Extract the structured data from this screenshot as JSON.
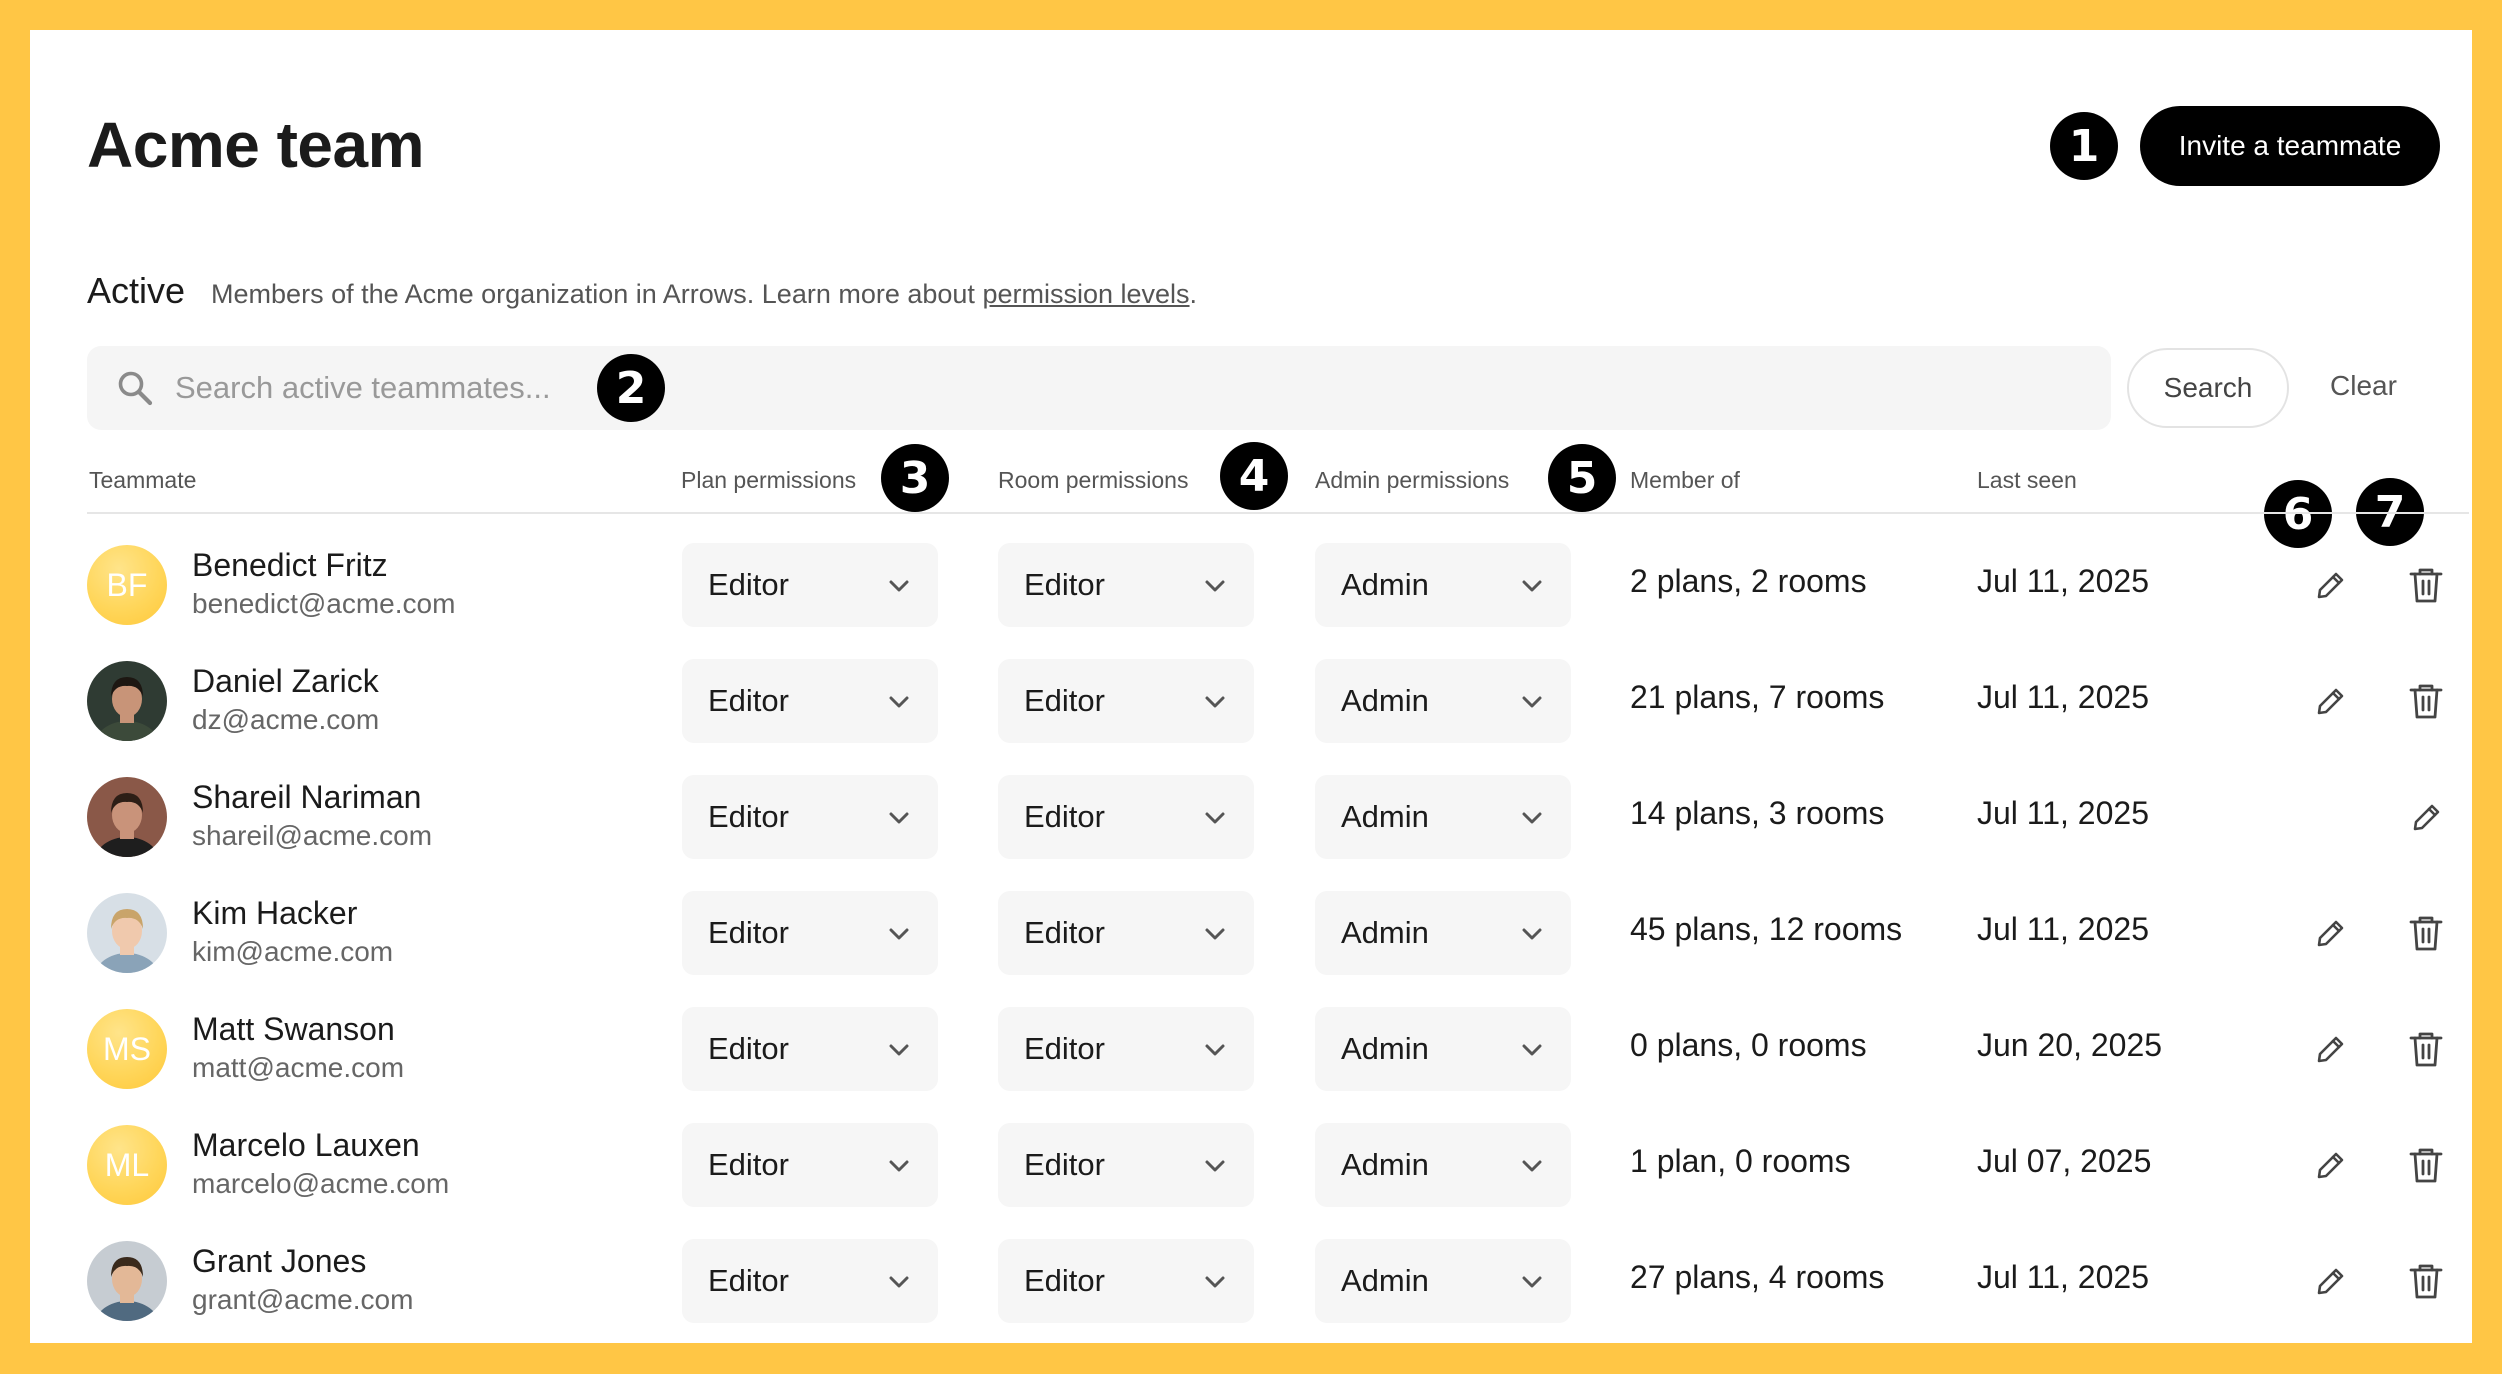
{
  "page": {
    "title": "Acme team",
    "invite_label": "Invite a teammate"
  },
  "section": {
    "title": "Active",
    "description": "Members of the Acme organization in Arrows. Learn more about",
    "link_text": "permission levels",
    "period": "."
  },
  "search": {
    "placeholder": "Search active teammates...",
    "button_label": "Search",
    "clear_label": "Clear"
  },
  "columns": {
    "teammate": "Teammate",
    "plan": "Plan permissions",
    "room": "Room permissions",
    "admin": "Admin permissions",
    "member_of": "Member of",
    "last_seen": "Last seen"
  },
  "callouts": [
    "1",
    "2",
    "3",
    "4",
    "5",
    "6",
    "7"
  ],
  "colors": {
    "background": "#FFC645",
    "accent_button": "#000000",
    "avatar_initials": "#FFD65A"
  },
  "icons": {
    "search": "search-icon",
    "dropdown": "chevron-down-icon",
    "edit": "pencil-icon",
    "delete": "trash-icon"
  },
  "rows": [
    {
      "name": "Benedict Fritz",
      "email": "benedict@acme.com",
      "avatar_initials": "BF",
      "avatar_type": "initials",
      "plan": "Editor",
      "room": "Editor",
      "admin": "Admin",
      "member_of": "2 plans, 2 rooms",
      "last_seen": "Jul 11, 2025",
      "can_delete": true
    },
    {
      "name": "Daniel Zarick",
      "email": "dz@acme.com",
      "avatar_initials": "",
      "avatar_type": "photo",
      "plan": "Editor",
      "room": "Editor",
      "admin": "Admin",
      "member_of": "21 plans, 7 rooms",
      "last_seen": "Jul 11, 2025",
      "can_delete": true
    },
    {
      "name": "Shareil Nariman",
      "email": "shareil@acme.com",
      "avatar_initials": "",
      "avatar_type": "photo",
      "plan": "Editor",
      "room": "Editor",
      "admin": "Admin",
      "member_of": "14 plans, 3 rooms",
      "last_seen": "Jul 11, 2025",
      "can_delete": false
    },
    {
      "name": "Kim Hacker",
      "email": "kim@acme.com",
      "avatar_initials": "",
      "avatar_type": "photo",
      "plan": "Editor",
      "room": "Editor",
      "admin": "Admin",
      "member_of": "45 plans, 12 rooms",
      "last_seen": "Jul 11, 2025",
      "can_delete": true
    },
    {
      "name": "Matt Swanson",
      "email": "matt@acme.com",
      "avatar_initials": "MS",
      "avatar_type": "initials",
      "plan": "Editor",
      "room": "Editor",
      "admin": "Admin",
      "member_of": "0 plans, 0 rooms",
      "last_seen": "Jun 20, 2025",
      "can_delete": true
    },
    {
      "name": "Marcelo Lauxen",
      "email": "marcelo@acme.com",
      "avatar_initials": "ML",
      "avatar_type": "initials",
      "plan": "Editor",
      "room": "Editor",
      "admin": "Admin",
      "member_of": "1 plan, 0 rooms",
      "last_seen": "Jul 07, 2025",
      "can_delete": true
    },
    {
      "name": "Grant Jones",
      "email": "grant@acme.com",
      "avatar_initials": "",
      "avatar_type": "photo",
      "plan": "Editor",
      "room": "Editor",
      "admin": "Admin",
      "member_of": "27 plans, 4 rooms",
      "last_seen": "Jul 11, 2025",
      "can_delete": true
    }
  ]
}
